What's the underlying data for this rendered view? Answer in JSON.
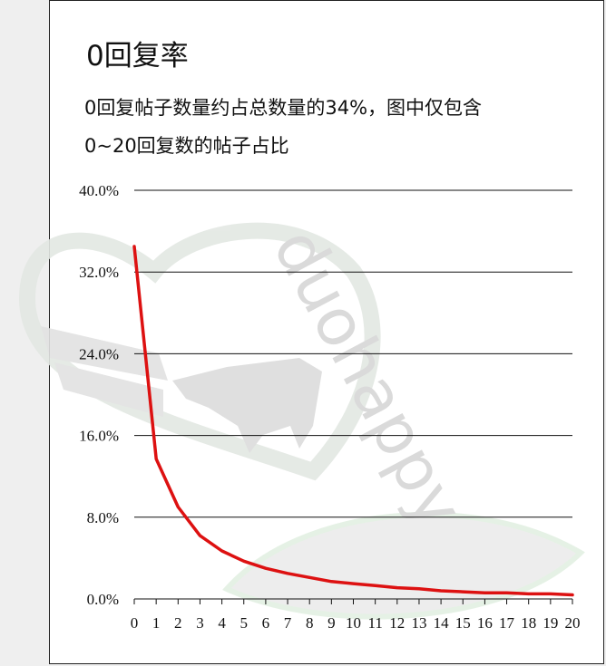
{
  "title": "0回复率",
  "description": {
    "line1": "0回复帖子数量约占总数量的34%，图中仅包含",
    "line2": "0~20回复数的帖子占比"
  },
  "watermark": {
    "text": "duohappy"
  },
  "colors": {
    "line": "#dd1111",
    "grid": "#111111",
    "watermark": "#d6d6d6"
  },
  "chart_data": {
    "type": "line",
    "x": [
      0,
      1,
      2,
      3,
      4,
      5,
      6,
      7,
      8,
      9,
      10,
      11,
      12,
      13,
      14,
      15,
      16,
      17,
      18,
      19,
      20
    ],
    "series": [
      {
        "values": [
          34.5,
          13.7,
          9.0,
          6.2,
          4.7,
          3.7,
          3.0,
          2.5,
          2.1,
          1.7,
          1.5,
          1.3,
          1.1,
          1.0,
          0.8,
          0.7,
          0.6,
          0.6,
          0.5,
          0.5,
          0.4
        ]
      }
    ],
    "ylim": [
      0,
      40
    ],
    "y_ticks": [
      "0.0%",
      "8.0%",
      "16.0%",
      "24.0%",
      "32.0%",
      "40.0%"
    ],
    "x_tick_labels": [
      "0",
      "1",
      "2",
      "3",
      "4",
      "5",
      "6",
      "7",
      "8",
      "9",
      "10",
      "11",
      "12",
      "13",
      "14",
      "15",
      "16",
      "17",
      "18",
      "19",
      "20"
    ],
    "grid": "horizontal"
  }
}
